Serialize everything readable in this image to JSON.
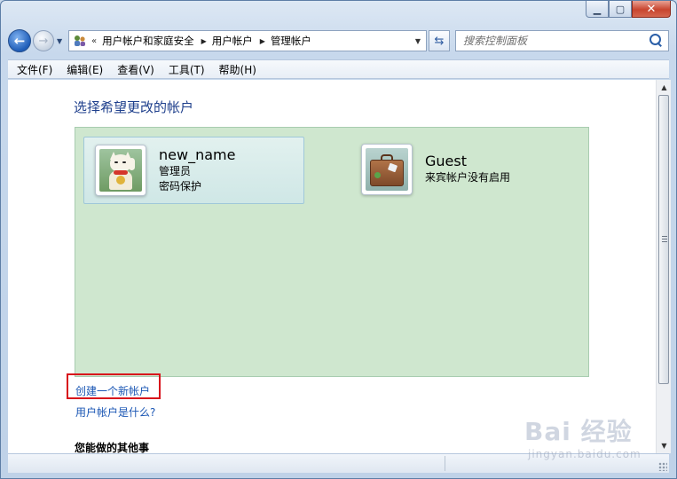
{
  "window": {
    "minimize_glyph": "▁",
    "maximize_glyph": "▢",
    "close_glyph": "✕"
  },
  "navbar": {
    "back_glyph": "←",
    "forward_glyph": "→",
    "history_glyph": "▼",
    "breadcrumb_prefix": "«",
    "breadcrumbs": [
      "用户帐户和家庭安全",
      "用户帐户",
      "管理帐户"
    ],
    "crumb_separator": "▶",
    "address_dropdown_glyph": "▼",
    "refresh_glyph": "⇆",
    "search_placeholder": "搜索控制面板"
  },
  "menubar": {
    "items": [
      "文件(F)",
      "编辑(E)",
      "查看(V)",
      "工具(T)",
      "帮助(H)"
    ]
  },
  "main": {
    "title": "选择希望更改的帐户",
    "accounts": [
      {
        "name": "new_name",
        "lines": [
          "管理员",
          "密码保护"
        ],
        "avatar_icon": "lucky-cat-icon",
        "selected": true
      },
      {
        "name": "Guest",
        "lines": [
          "来宾帐户没有启用"
        ],
        "avatar_icon": "suitcase-icon",
        "selected": false
      }
    ],
    "create_account_link": "创建一个新帐户",
    "what_is_link": "用户帐户是什么?",
    "other_section_title": "您能做的其他事"
  },
  "scrollbar": {
    "up_glyph": "▲",
    "down_glyph": "▼"
  },
  "watermark": {
    "logo": "Bai  经验",
    "sub": "jingyan.baidu.com"
  },
  "colors": {
    "panel_bg": "#cfe7cf",
    "link": "#1a56b4",
    "title": "#1e3f8c",
    "highlight": "#d8131b"
  }
}
